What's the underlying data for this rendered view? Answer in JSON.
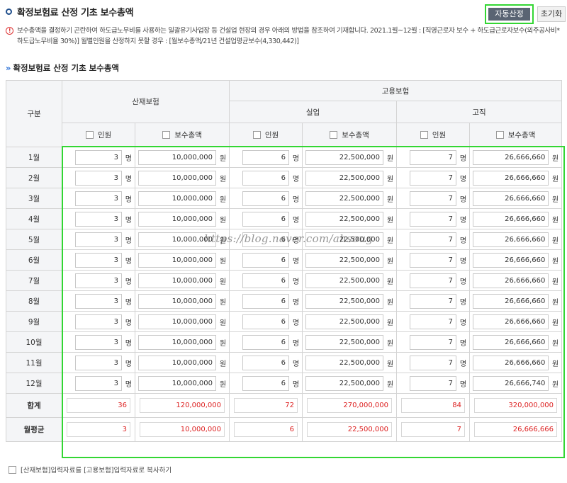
{
  "header": {
    "title": "확정보험료 산정 기초 보수총액",
    "auto_button": "자동산정",
    "reset_button": "초기화"
  },
  "notice": {
    "text": "보수총액을 결정하기 곤란하여 하도급노무비를 사용하는 일괄유기사업장 등 건설업 현장의 경우 아래의 방법을 참조하여 기재합니다. 2021.1월~12월 : [직영근로자 보수 + 하도급근로자보수(외주공사비*하도급노무비율 30%)] 월별인원을 산정하지 못할 경우 : [월보수총액/21년 건설업평균보수(4,330,442)]"
  },
  "section": {
    "title": "확정보험료 산정 기초 보수총액"
  },
  "table": {
    "head": {
      "category": "구분",
      "sanjae": "산재보험",
      "goyong": "고용보험",
      "sileop": "실업",
      "gojik": "고직",
      "count_label": "인원",
      "amount_label": "보수총액"
    },
    "units": {
      "person": "명",
      "won": "원"
    },
    "rows": [
      {
        "month": "1월",
        "sj_cnt": "3",
        "sj_amt": "10,000,000",
        "su_cnt": "6",
        "su_amt": "22,500,000",
        "gj_cnt": "7",
        "gj_amt": "26,666,660"
      },
      {
        "month": "2월",
        "sj_cnt": "3",
        "sj_amt": "10,000,000",
        "su_cnt": "6",
        "su_amt": "22,500,000",
        "gj_cnt": "7",
        "gj_amt": "26,666,660"
      },
      {
        "month": "3월",
        "sj_cnt": "3",
        "sj_amt": "10,000,000",
        "su_cnt": "6",
        "su_amt": "22,500,000",
        "gj_cnt": "7",
        "gj_amt": "26,666,660"
      },
      {
        "month": "4월",
        "sj_cnt": "3",
        "sj_amt": "10,000,000",
        "su_cnt": "6",
        "su_amt": "22,500,000",
        "gj_cnt": "7",
        "gj_amt": "26,666,660"
      },
      {
        "month": "5월",
        "sj_cnt": "3",
        "sj_amt": "10,000,000",
        "su_cnt": "6",
        "su_amt": "22,500,000",
        "gj_cnt": "7",
        "gj_amt": "26,666,660"
      },
      {
        "month": "6월",
        "sj_cnt": "3",
        "sj_amt": "10,000,000",
        "su_cnt": "6",
        "su_amt": "22,500,000",
        "gj_cnt": "7",
        "gj_amt": "26,666,660"
      },
      {
        "month": "7월",
        "sj_cnt": "3",
        "sj_amt": "10,000,000",
        "su_cnt": "6",
        "su_amt": "22,500,000",
        "gj_cnt": "7",
        "gj_amt": "26,666,660"
      },
      {
        "month": "8월",
        "sj_cnt": "3",
        "sj_amt": "10,000,000",
        "su_cnt": "6",
        "su_amt": "22,500,000",
        "gj_cnt": "7",
        "gj_amt": "26,666,660"
      },
      {
        "month": "9월",
        "sj_cnt": "3",
        "sj_amt": "10,000,000",
        "su_cnt": "6",
        "su_amt": "22,500,000",
        "gj_cnt": "7",
        "gj_amt": "26,666,660"
      },
      {
        "month": "10월",
        "sj_cnt": "3",
        "sj_amt": "10,000,000",
        "su_cnt": "6",
        "su_amt": "22,500,000",
        "gj_cnt": "7",
        "gj_amt": "26,666,660"
      },
      {
        "month": "11월",
        "sj_cnt": "3",
        "sj_amt": "10,000,000",
        "su_cnt": "6",
        "su_amt": "22,500,000",
        "gj_cnt": "7",
        "gj_amt": "26,666,660"
      },
      {
        "month": "12월",
        "sj_cnt": "3",
        "sj_amt": "10,000,000",
        "su_cnt": "6",
        "su_amt": "22,500,000",
        "gj_cnt": "7",
        "gj_amt": "26,666,740"
      }
    ],
    "total": {
      "label": "합계",
      "sj_cnt": "36",
      "sj_amt": "120,000,000",
      "su_cnt": "72",
      "su_amt": "270,000,000",
      "gj_cnt": "84",
      "gj_amt": "320,000,000"
    },
    "average": {
      "label": "월평균",
      "sj_cnt": "3",
      "sj_amt": "10,000,000",
      "su_cnt": "6",
      "su_amt": "22,500,000",
      "gj_cnt": "7",
      "gj_amt": "26,666,666"
    }
  },
  "copy_option": {
    "label": "[산재보험]입력자료를 [고용보험]입력자료로 복사하기"
  },
  "watermark": "https://blog.naver.com/ahsoug",
  "colors": {
    "highlight": "#33d633",
    "sum_text": "#dd2222",
    "auto_button_bg": "#5a6473"
  }
}
